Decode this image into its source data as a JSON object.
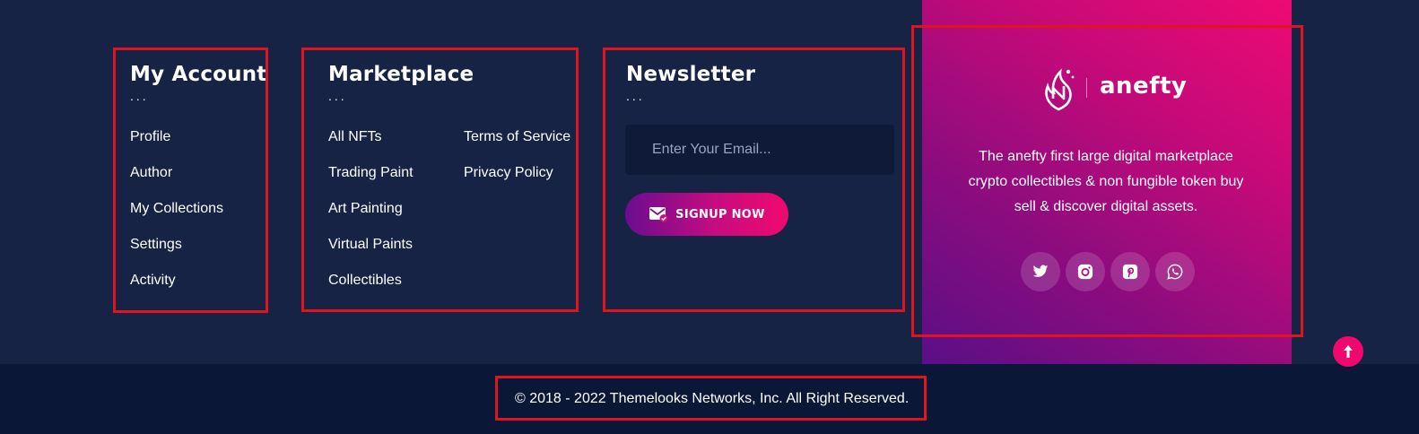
{
  "account": {
    "title": "My Account",
    "dots": "...",
    "links": [
      "Profile",
      "Author",
      "My Collections",
      "Settings",
      "Activity"
    ]
  },
  "marketplace": {
    "title": "Marketplace",
    "dots": "...",
    "links_left": [
      "All NFTs",
      "Trading Paint",
      "Art Painting",
      "Virtual Paints",
      "Collectibles"
    ],
    "links_right": [
      "Terms of Service",
      "Privacy Policy"
    ]
  },
  "newsletter": {
    "title": "Newsletter",
    "dots": "...",
    "email_placeholder": "Enter Your Email...",
    "signup_label": "SIGNUP NOW",
    "signup_icon": "mail-check-icon"
  },
  "promo": {
    "logo_text": "anefty",
    "logo_icon": "flame-logo-icon",
    "description": "The anefty first large digital marketplace crypto collectibles & non fungible token buy sell & discover digital assets.",
    "socials": [
      "twitter-icon",
      "instagram-icon",
      "pinterest-icon",
      "whatsapp-icon"
    ]
  },
  "footer": {
    "copyright": "© 2018 - 2022 Themelooks Networks, Inc. All Right Reserved."
  },
  "colors": {
    "background": "#162345",
    "bottom_bar": "#0b1736",
    "accent_pink": "#f0086e",
    "accent_purple": "#5a0f86",
    "highlight_box": "#e0141e"
  }
}
